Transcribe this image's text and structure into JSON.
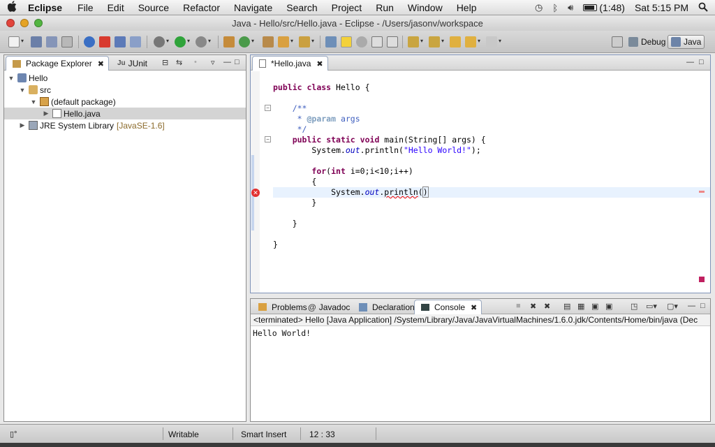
{
  "menubar": {
    "app": "Eclipse",
    "menus": [
      "File",
      "Edit",
      "Source",
      "Refactor",
      "Navigate",
      "Search",
      "Project",
      "Run",
      "Window",
      "Help"
    ],
    "battery": "(1:48)",
    "clock": "Sat 5:15 PM"
  },
  "window": {
    "title": "Java - Hello/src/Hello.java - Eclipse - /Users/jasonv/workspace"
  },
  "perspectives": {
    "debug": "Debug",
    "java": "Java"
  },
  "package_explorer": {
    "tab_label": "Package Explorer",
    "junit_tab": "JUnit",
    "tree": [
      {
        "label": "Hello",
        "depth": 0,
        "expanded": true
      },
      {
        "label": "src",
        "depth": 1,
        "expanded": true
      },
      {
        "label": "(default package)",
        "depth": 2,
        "expanded": true
      },
      {
        "label": "Hello.java",
        "depth": 3,
        "expanded": false,
        "selected": true
      },
      {
        "label": "JRE System Library",
        "suffix": "[JavaSE-1.6]",
        "depth": 1,
        "expanded": false
      }
    ]
  },
  "editor": {
    "tab_label": "*Hello.java",
    "lines": [
      "public class Hello {",
      "",
      "    /**",
      "     * @param args",
      "     */",
      "    public static void main(String[] args) {",
      "        System.out.println(\"Hello World!\");",
      "",
      "        for(int i=0;i<10;i++)",
      "        {",
      "            System.out.println()",
      "        }",
      "",
      "    }",
      "",
      "}"
    ]
  },
  "bottom_panel": {
    "tabs": [
      "Problems",
      "Javadoc",
      "Declaration",
      "Console"
    ],
    "active_tab": "Console",
    "console_header": "<terminated> Hello [Java Application] /System/Library/Java/JavaVirtualMachines/1.6.0.jdk/Contents/Home/bin/java (Dec",
    "console_output": "Hello World!"
  },
  "statusbar": {
    "writable": "Writable",
    "insert_mode": "Smart Insert",
    "position": "12 : 33"
  },
  "colors": {
    "keyword": "#7f0055",
    "comment": "#3f5fbf",
    "string": "#2a00ff",
    "field": "#0000c0",
    "error": "#e00000"
  }
}
